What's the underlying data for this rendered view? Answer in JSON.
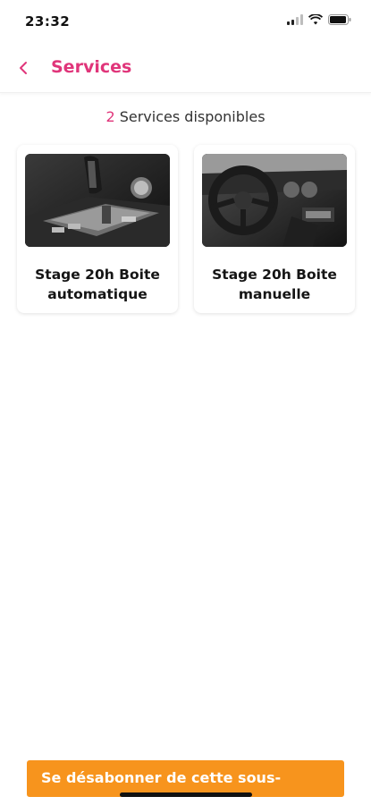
{
  "status_bar": {
    "time": "23:32"
  },
  "header": {
    "title": "Services"
  },
  "summary": {
    "count": "2",
    "label": " Services disponibles"
  },
  "services": [
    {
      "title": "Stage 20h Boite automatique"
    },
    {
      "title": "Stage 20h Boite manuelle"
    }
  ],
  "footer": {
    "unsubscribe_label": "Se désabonner de cette sous-"
  },
  "colors": {
    "accent": "#e0357a",
    "button": "#f7941d"
  }
}
